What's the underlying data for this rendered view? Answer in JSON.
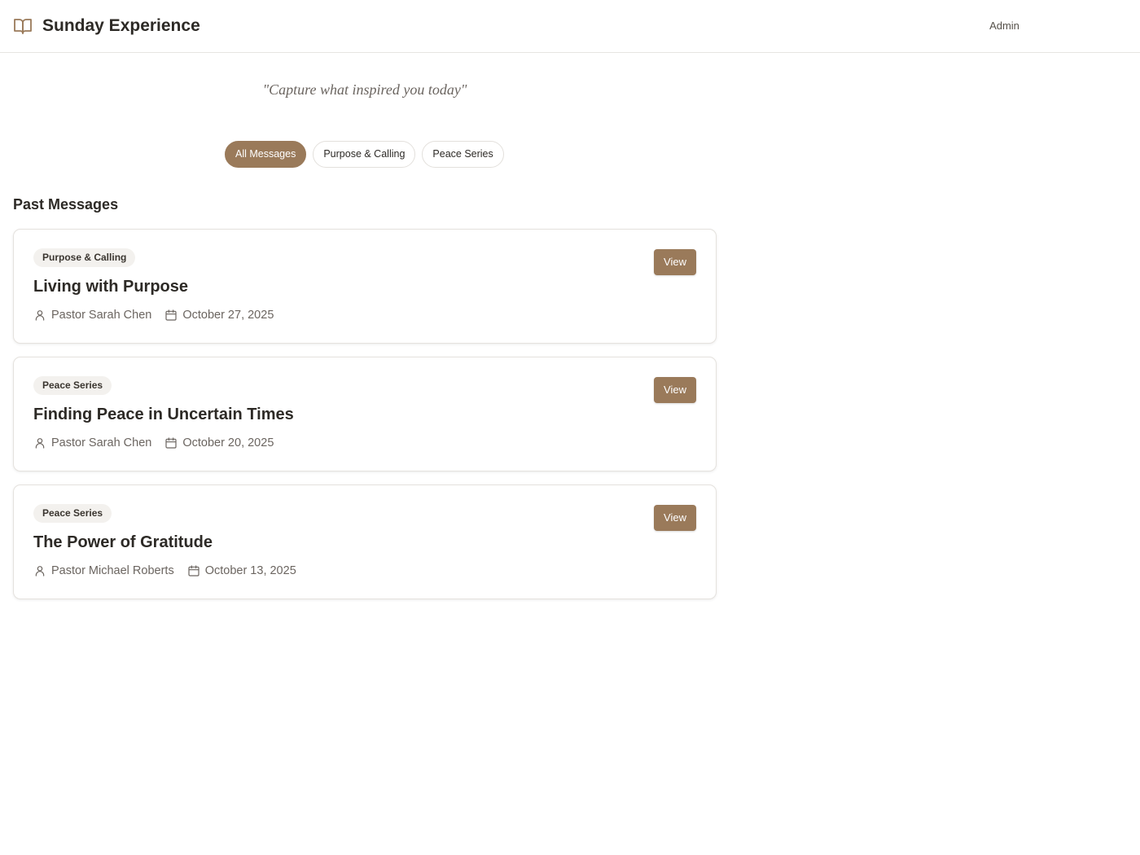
{
  "header": {
    "title": "Sunday Experience",
    "admin_label": "Admin"
  },
  "tagline": "\"Capture what inspired you today\"",
  "filters": [
    {
      "label": "All Messages",
      "active": true
    },
    {
      "label": "Purpose & Calling",
      "active": false
    },
    {
      "label": "Peace Series",
      "active": false
    }
  ],
  "section_title": "Past Messages",
  "messages": [
    {
      "series": "Purpose & Calling",
      "title": "Living with Purpose",
      "speaker": "Pastor Sarah Chen",
      "date": "October 27, 2025",
      "view_label": "View"
    },
    {
      "series": "Peace Series",
      "title": "Finding Peace in Uncertain Times",
      "speaker": "Pastor Sarah Chen",
      "date": "October 20, 2025",
      "view_label": "View"
    },
    {
      "series": "Peace Series",
      "title": "The Power of Gratitude",
      "speaker": "Pastor Michael Roberts",
      "date": "October 13, 2025",
      "view_label": "View"
    }
  ],
  "icons": {
    "brand": "book-open-icon",
    "speaker": "user-icon",
    "date": "calendar-icon"
  },
  "colors": {
    "accent": "#9a7a5a",
    "text": "#2d2a26",
    "muted": "#6b6560",
    "border": "#e5e2de"
  }
}
